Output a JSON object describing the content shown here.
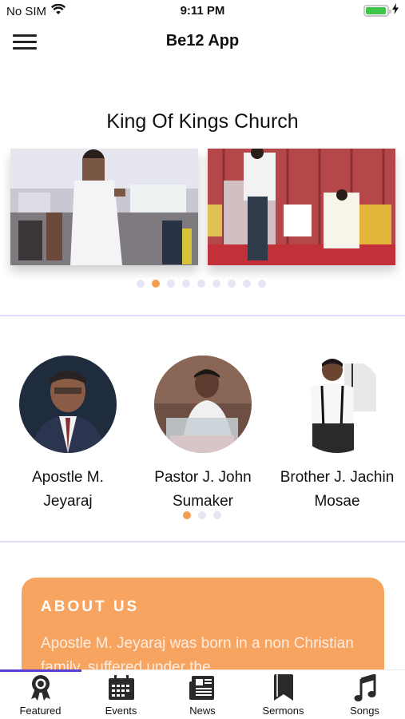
{
  "status_bar": {
    "carrier": "No SIM",
    "time": "9:11 PM",
    "battery_level": 0.95,
    "battery_color": "#3ec54a"
  },
  "header": {
    "title": "Be12 App",
    "menu_icon": "hamburger-menu-icon"
  },
  "church": {
    "title": "King Of Kings Church",
    "slide_count": 9,
    "active_slide": 1
  },
  "leaders": {
    "items": [
      {
        "name_line1": "Apostle M.",
        "name_line2": "Jeyaraj"
      },
      {
        "name_line1": "Pastor J. John",
        "name_line2": "Sumaker"
      },
      {
        "name_line1": "Brother J. Jachin",
        "name_line2": "Mosae"
      }
    ],
    "page_count": 3,
    "active_page": 0
  },
  "about": {
    "title": "ABOUT US",
    "text": "Apostle M. Jeyaraj was born in a non Christian family, suffered under the",
    "accent": "#f8a461"
  },
  "bottom_nav": {
    "active": "Featured",
    "indicator_color": "#5b3fd1",
    "items": [
      {
        "label": "Featured",
        "icon": "award-ribbon-icon"
      },
      {
        "label": "Events",
        "icon": "calendar-icon"
      },
      {
        "label": "News",
        "icon": "newspaper-icon"
      },
      {
        "label": "Sermons",
        "icon": "bookmark-icon"
      },
      {
        "label": "Songs",
        "icon": "music-note-icon"
      }
    ]
  }
}
